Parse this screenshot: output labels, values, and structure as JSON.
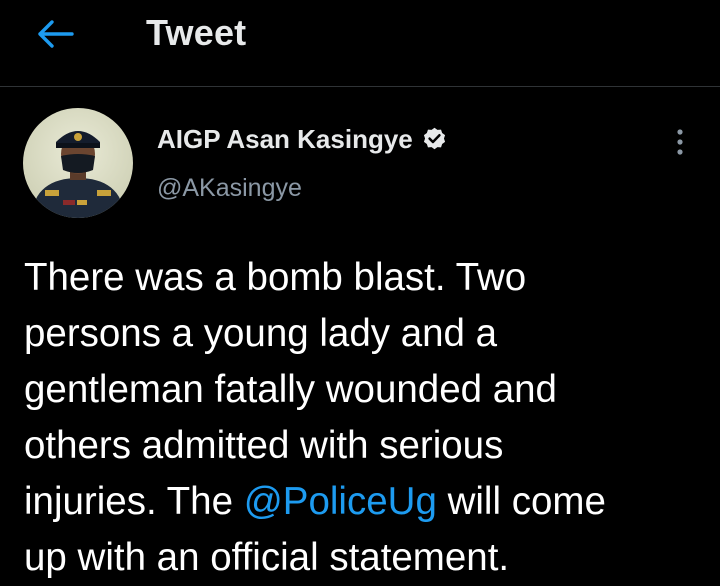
{
  "header": {
    "title": "Tweet",
    "back_icon": "arrow-left-icon"
  },
  "colors": {
    "background": "#000000",
    "accent": "#1d9bf0",
    "text_primary": "#e7e9ea",
    "text_secondary": "#8b98a5",
    "divider": "#2f3336"
  },
  "tweet": {
    "author": {
      "display_name": "AIGP Asan Kasingye",
      "handle": "@AKasingye",
      "verified": true,
      "verified_icon": "verified-badge-icon",
      "avatar_icon": "avatar"
    },
    "more_icon": "more-vertical-icon",
    "text_before": "There was a bomb blast. Two\npersons a young lady and a\ngentleman fatally wounded and\nothers admitted with serious\ninjuries. The ",
    "mention": "@PoliceUg",
    "text_after": " will come\nup with an official statement."
  }
}
